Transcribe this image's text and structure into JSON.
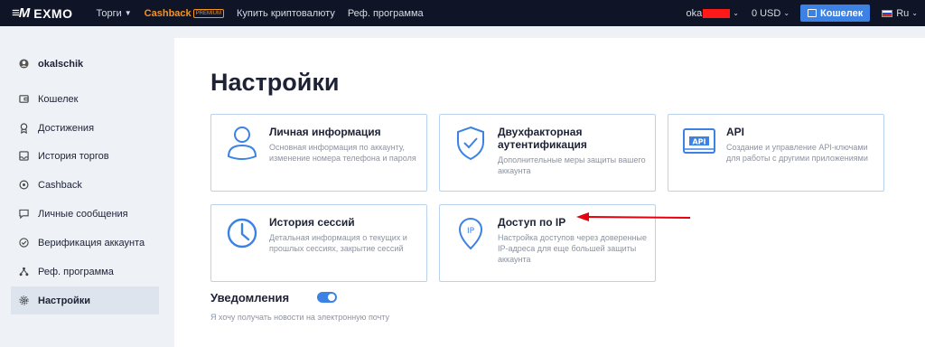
{
  "topbar": {
    "logo_mark": "≡M",
    "logo_text": "EXMO",
    "nav": [
      {
        "label": "Торги",
        "chevron": true
      },
      {
        "label": "Cashback",
        "badge": "PREMIUM"
      },
      {
        "label": "Купить криптовалюту"
      },
      {
        "label": "Реф. программа"
      }
    ],
    "user_prefix": "oka",
    "balance": "0 USD",
    "wallet_button": "Кошелек",
    "language": "Ru"
  },
  "sidebar": {
    "username": "okalschik",
    "items": [
      {
        "label": "Кошелек",
        "icon": "wallet-icon"
      },
      {
        "label": "Достижения",
        "icon": "achievement-icon"
      },
      {
        "label": "История торгов",
        "icon": "history-icon"
      },
      {
        "label": "Cashback",
        "icon": "cashback-icon"
      },
      {
        "label": "Личные сообщения",
        "icon": "message-icon"
      },
      {
        "label": "Верификация аккаунта",
        "icon": "verify-icon"
      },
      {
        "label": "Реф. программа",
        "icon": "referral-icon"
      },
      {
        "label": "Настройки",
        "icon": "settings-icon",
        "active": true
      }
    ]
  },
  "main": {
    "title": "Настройки",
    "cards": [
      {
        "title": "Личная информация",
        "desc": "Основная информация по аккаунту, изменение номера телефона и пароля",
        "icon": "user-icon"
      },
      {
        "title": "Двухфакторная аутентификация",
        "desc": "Дополнительные меры защиты вашего аккаунта",
        "icon": "shield-check-icon"
      },
      {
        "title": "API",
        "desc": "Создание и управление API-ключами для работы с другими приложениями",
        "icon": "api-icon"
      },
      {
        "title": "История сессий",
        "desc": "Детальная информация о текущих и прошлых сессиях, закрытие сессий",
        "icon": "clock-icon"
      },
      {
        "title": "Доступ по IP",
        "desc": "Настройка доступов через доверенные IP-адреса для еще большей защиты аккаунта",
        "icon": "ip-pin-icon"
      }
    ],
    "notifications_label": "Уведомления",
    "notifications_desc": "Я хочу получать новости на электронную почту",
    "notifications_on": true
  },
  "colors": {
    "topbar": "#0f1526",
    "accent": "#3c82e5",
    "cashback": "#f7931e",
    "annotation_arrow": "#e3000f"
  }
}
